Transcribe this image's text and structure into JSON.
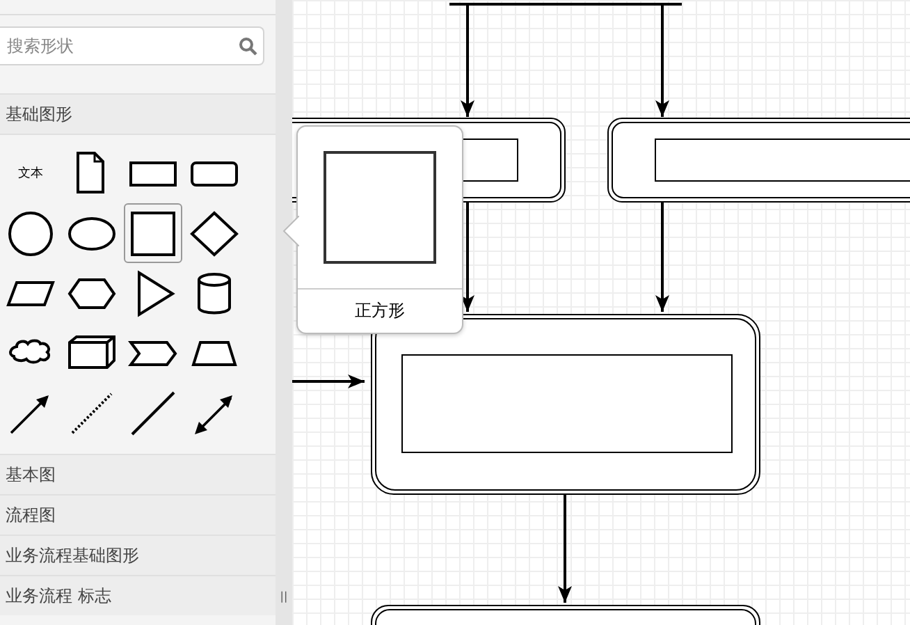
{
  "sidebar": {
    "search": {
      "placeholder": "搜索形状"
    },
    "palette": {
      "title": "基础图形",
      "expanded": true,
      "shapes": [
        {
          "kind": "text",
          "label": "文本",
          "selected": false
        },
        {
          "kind": "note",
          "selected": false
        },
        {
          "kind": "rect",
          "selected": false
        },
        {
          "kind": "rounded",
          "selected": false
        },
        {
          "kind": "circle",
          "selected": false
        },
        {
          "kind": "ellipse",
          "selected": false
        },
        {
          "kind": "square",
          "selected": true
        },
        {
          "kind": "diamond",
          "selected": false
        },
        {
          "kind": "parallelogram",
          "selected": false
        },
        {
          "kind": "hexagon",
          "selected": false
        },
        {
          "kind": "triangle",
          "selected": false
        },
        {
          "kind": "cylinder",
          "selected": false
        },
        {
          "kind": "cloud",
          "selected": false
        },
        {
          "kind": "cube",
          "selected": false
        },
        {
          "kind": "step",
          "selected": false
        },
        {
          "kind": "trapezoid",
          "selected": false
        },
        {
          "kind": "arrow",
          "selected": false
        },
        {
          "kind": "dotted",
          "selected": false
        },
        {
          "kind": "line",
          "selected": false
        },
        {
          "kind": "bidirectional",
          "selected": false
        }
      ]
    },
    "categories": [
      {
        "label": "基本图"
      },
      {
        "label": "流程图"
      },
      {
        "label": "业务流程基础图形"
      },
      {
        "label": "业务流程 标志"
      }
    ]
  },
  "splitter": {
    "handle": "||"
  },
  "tooltip": {
    "label": "正方形"
  }
}
